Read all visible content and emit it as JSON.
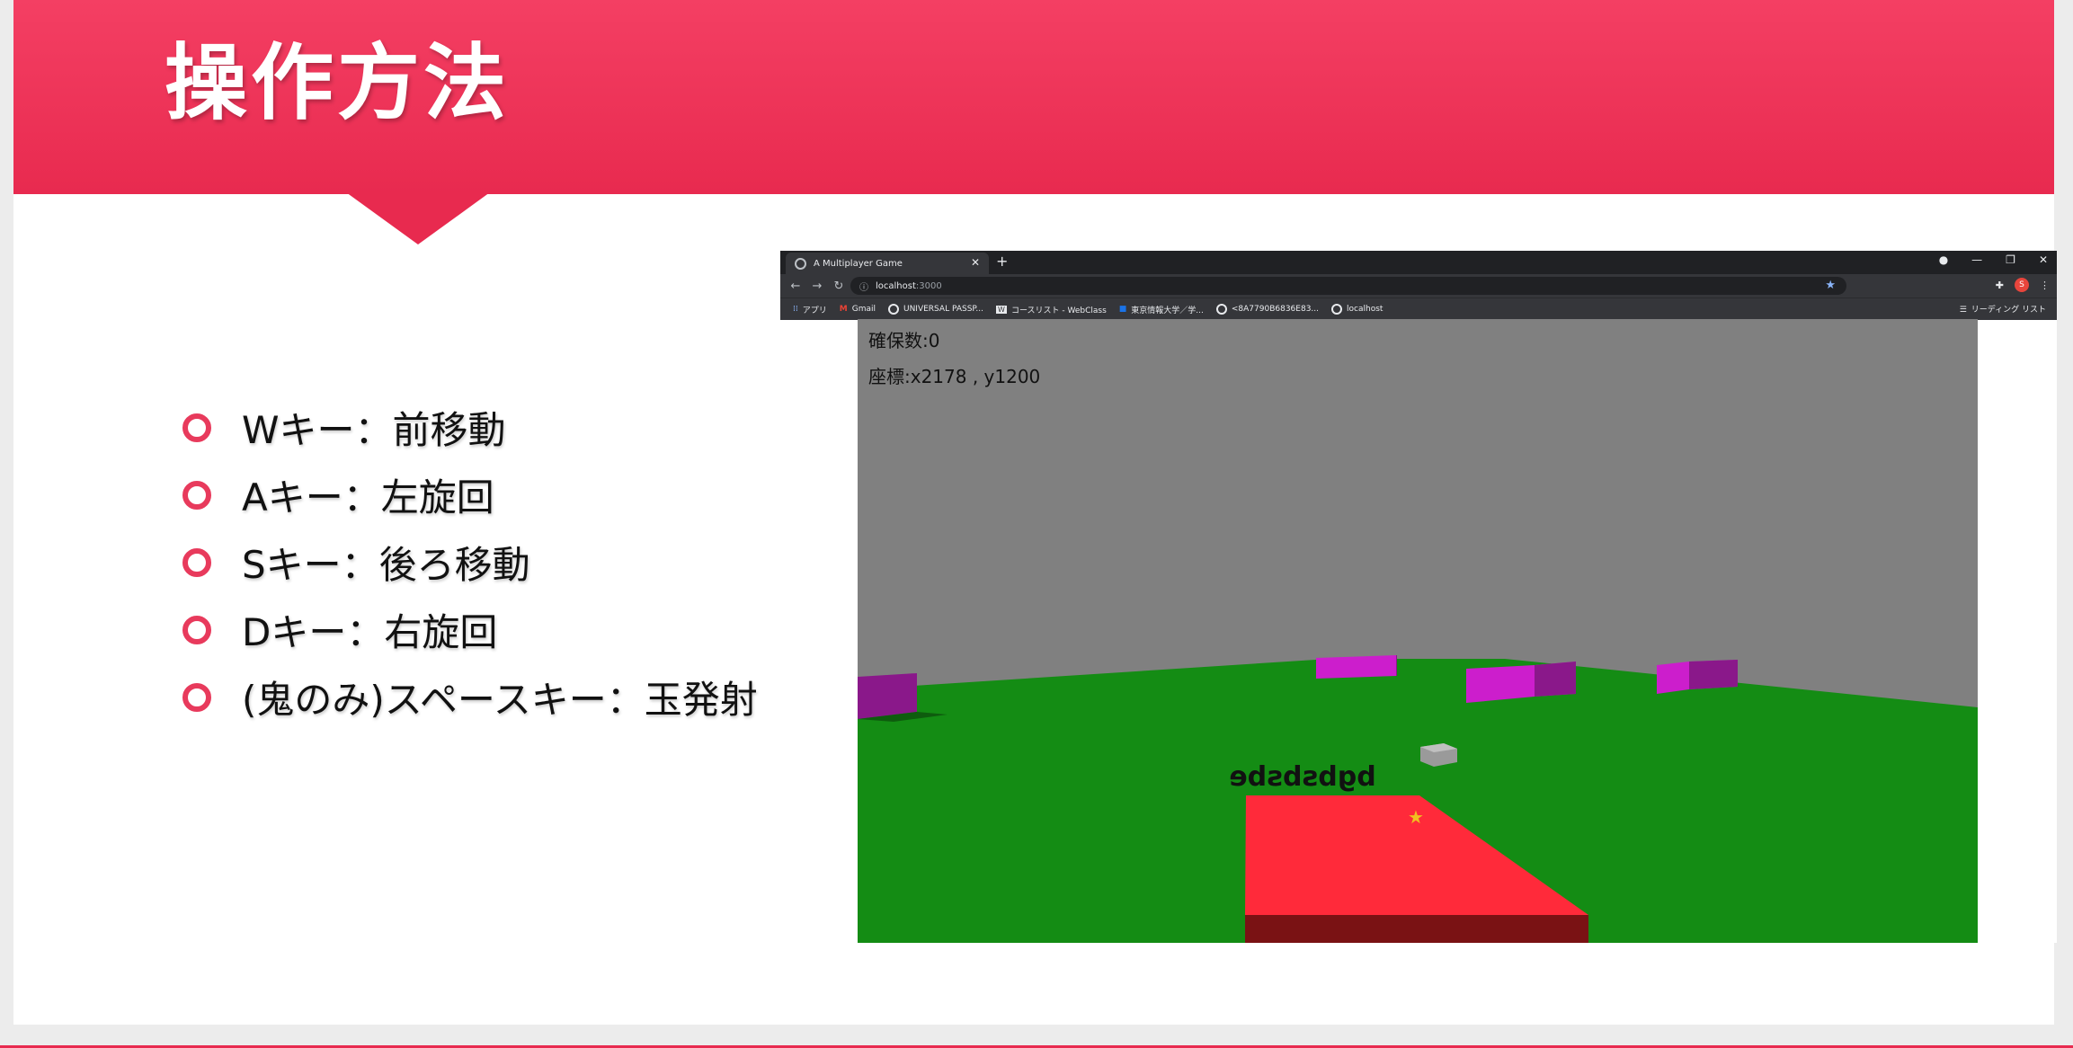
{
  "slide": {
    "title": "操作方法",
    "bullets": [
      "Wキー：前移動",
      "Aキー：左旋回",
      "Sキー：後ろ移動",
      "Dキー：右旋回",
      "(鬼のみ)スペースキー：玉発射"
    ],
    "accent_color": "#e82a4f"
  },
  "browser": {
    "tab_title": "A Multiplayer Game",
    "url_host": "localhost",
    "url_port": ":3000",
    "bookmarks": [
      "アプリ",
      "Gmail",
      "UNIVERSAL PASSP...",
      "コースリスト - WebClass",
      "東京情報大学／学...",
      "<8A7790B6836E83...",
      "localhost"
    ],
    "reading_list": "リーディング リスト",
    "profile_initial": "S"
  },
  "game": {
    "count_text": "確保数:0",
    "coords_text": "座標:x2178 , y1200",
    "player_name": "bgbsbsbe",
    "floor_color": "#148c14",
    "wall_color": "#808080",
    "player_color": "#ff2a3a",
    "obstacle_color": "#cc1ecc"
  }
}
